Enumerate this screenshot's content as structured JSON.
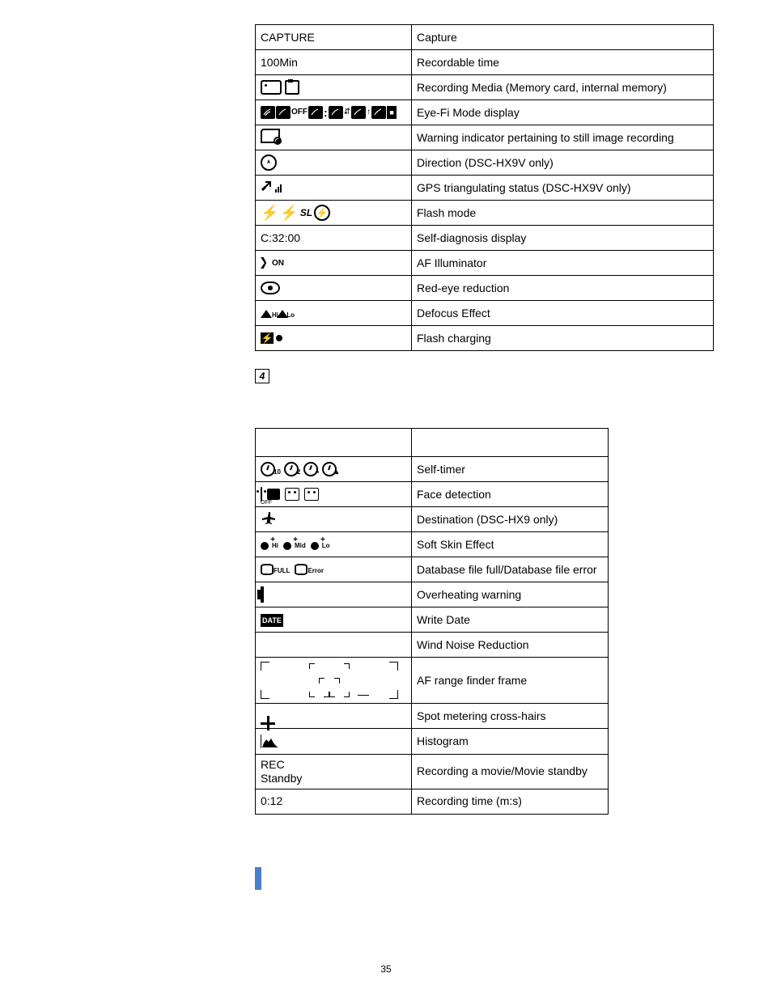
{
  "page_number": "35",
  "section_marker": "4",
  "table1": {
    "rows": [
      {
        "display": "CAPTURE",
        "desc": "Capture"
      },
      {
        "display": "100Min",
        "desc": "Recordable time"
      },
      {
        "display_icon": "media",
        "desc": "Recording Media (Memory card, internal memory)"
      },
      {
        "display_icon": "eyefi",
        "off_text": "OFF",
        "desc": "Eye-Fi Mode display"
      },
      {
        "display_icon": "cam-warn",
        "desc": "Warning indicator pertaining to still image recording"
      },
      {
        "display_icon": "direction",
        "desc": "Direction (DSC-HX9V only)"
      },
      {
        "display_icon": "gps",
        "desc": "GPS triangulating status (DSC-HX9V only)"
      },
      {
        "display_icon": "flash-mode",
        "sl_text": "SL",
        "desc": "Flash mode"
      },
      {
        "display": "C:32:00",
        "desc": "Self-diagnosis display"
      },
      {
        "display_icon": "af-illum",
        "on_text": "ON",
        "desc": "AF Illuminator"
      },
      {
        "display_icon": "redeye",
        "desc": "Red-eye reduction"
      },
      {
        "display_icon": "defocus",
        "hi": "Hi",
        "lo": "Lo",
        "desc": "Defocus Effect"
      },
      {
        "display_icon": "flash-charge",
        "desc": "Flash charging"
      }
    ]
  },
  "table2": {
    "rows": [
      {
        "display_icon": "selftimer",
        "s10": "10",
        "s2": "2",
        "desc": "Self-timer"
      },
      {
        "display_icon": "face",
        "off": "OFF",
        "desc": "Face detection"
      },
      {
        "display_icon": "airplane",
        "desc": "Destination (DSC-HX9 only)"
      },
      {
        "display_icon": "softskin",
        "hi": "Hi",
        "mid": "Mid",
        "lo": "Lo",
        "desc": "Soft Skin Effect"
      },
      {
        "display_icon": "dbfile",
        "full": "FULL",
        "err": "Error",
        "desc": "Database file full/Database file error"
      },
      {
        "display_icon": "overheat",
        "desc": "Overheating warning"
      },
      {
        "display_icon": "date-badge",
        "badge": "DATE",
        "desc": "Write Date"
      },
      {
        "display_icon": "wind",
        "desc": "Wind Noise Reduction"
      },
      {
        "display_icon": "af-frame",
        "desc": "AF range finder frame"
      },
      {
        "display_icon": "crosshair",
        "desc": "Spot metering cross-hairs"
      },
      {
        "display_icon": "histogram",
        "desc": "Histogram"
      },
      {
        "display": "REC\nStandby",
        "desc": "Recording a movie/Movie standby"
      },
      {
        "display": "0:12",
        "desc": "Recording time (m:s)"
      }
    ]
  }
}
